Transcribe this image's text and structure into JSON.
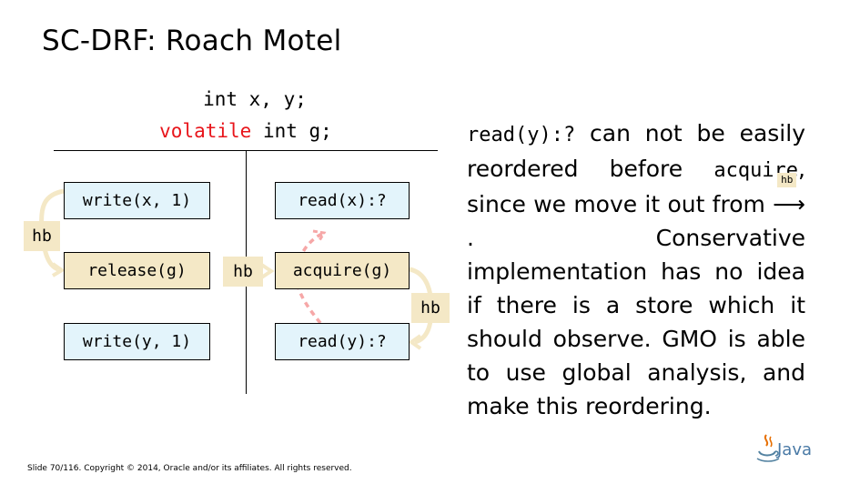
{
  "slide": {
    "title": "SC-DRF: Roach Motel",
    "declarations": {
      "line1": "int x, y;",
      "line2_keyword": "volatile",
      "line2_rest": " int g;"
    },
    "thread1": {
      "op1": "write(x, 1)",
      "op2": "release(g)",
      "op3": "write(y, 1)"
    },
    "thread2": {
      "op1": "read(x):?",
      "op2": "acquire(g)",
      "op3": "read(y):?"
    },
    "hb_labels": {
      "left": "hb",
      "middle": "hb",
      "right": "hb"
    },
    "explanation": {
      "p1_code1": "read(y):?",
      "p1_text1": " can not be easily reordered before ",
      "p1_code2": "acquire",
      "p1_text2": ", since we move it out from ",
      "arrow_label": "hb",
      "arrow": "⟶",
      "p1_text3": ". Conservative implementation has no idea if there is a store which it should observe. GMO is able to use global analysis, and make this reordering."
    },
    "footer": "Slide 70/116. Copyright © 2014, Oracle and/or its affiliates. All rights reserved.",
    "logo_text": "Java"
  }
}
